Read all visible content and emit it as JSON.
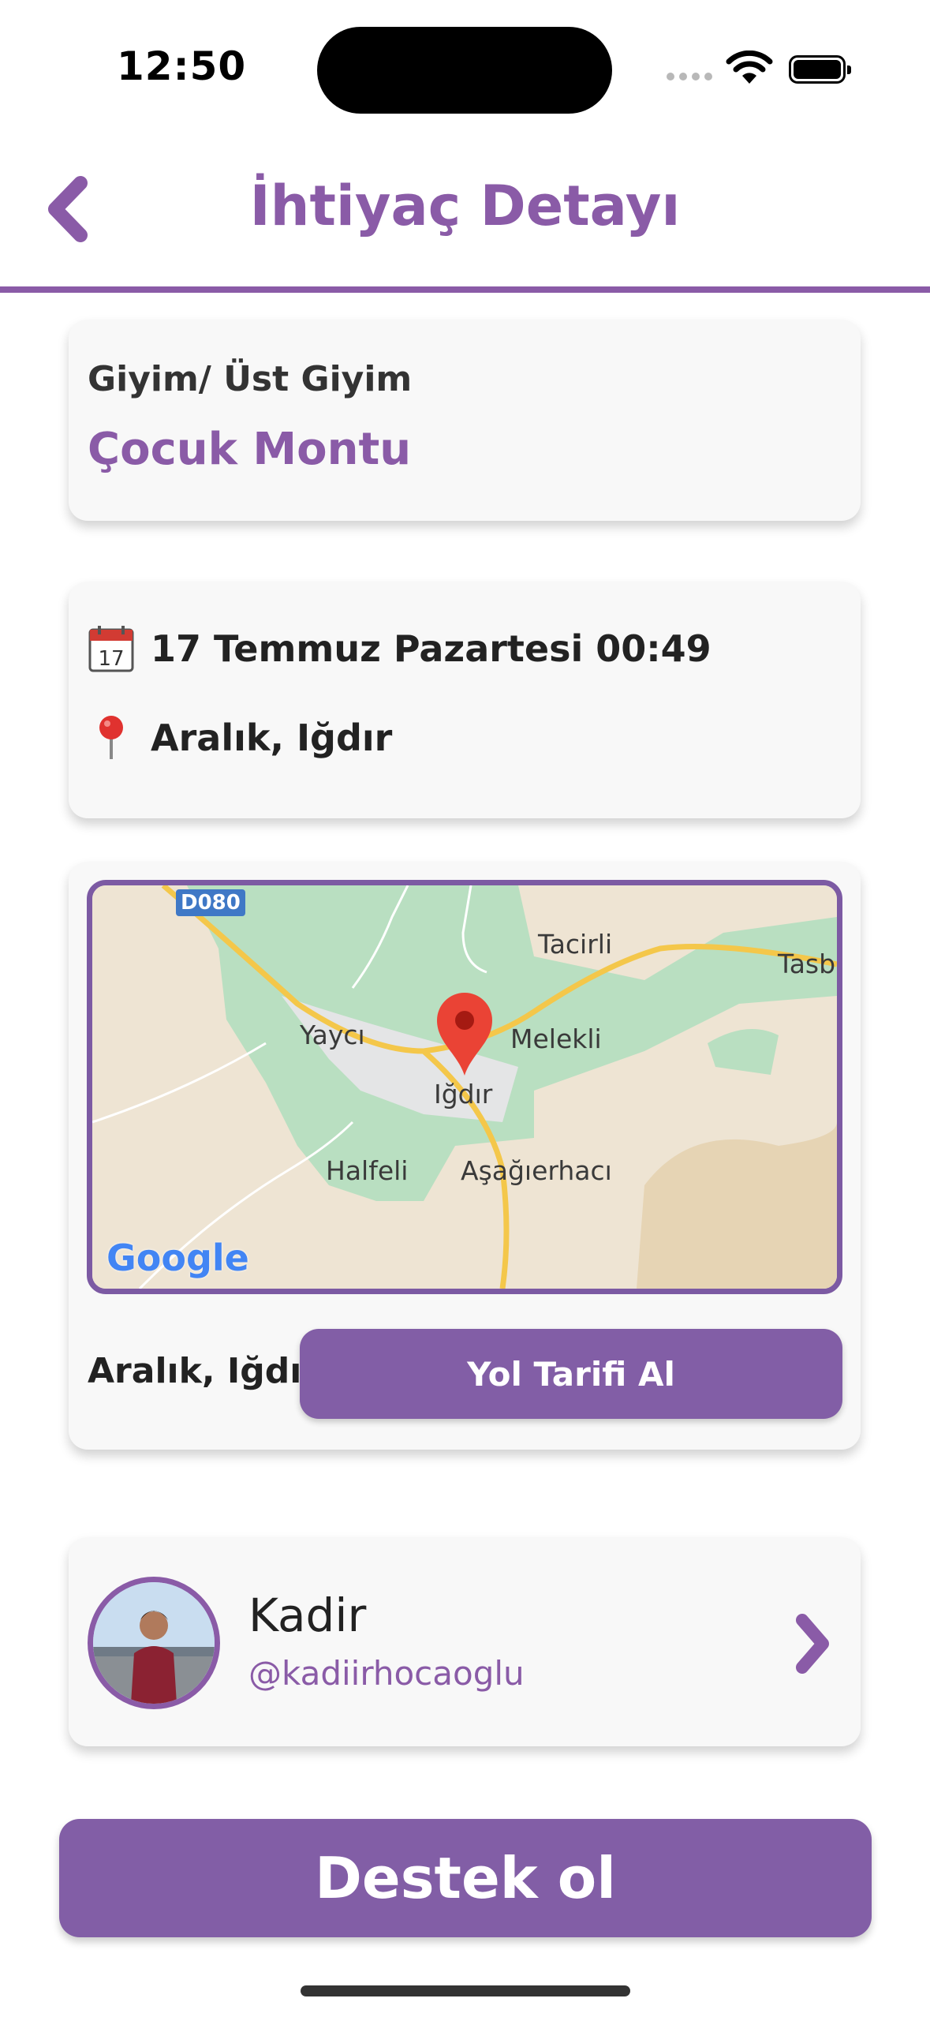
{
  "status_bar": {
    "time": "12:50"
  },
  "header": {
    "title": "İhtiyaç Detayı"
  },
  "need": {
    "category": "Giyim/ Üst Giyim",
    "item": "Çocuk Montu"
  },
  "info": {
    "date": "17 Temmuz Pazartesi 00:49",
    "location": "Aralık, Iğdır"
  },
  "map": {
    "road_badge": "D080",
    "places": [
      "Tacirli",
      "Tasbu",
      "Yaycı",
      "Melekli",
      "Iğdır",
      "Halfeli",
      "Aşağıerhacı"
    ],
    "google_logo": "Google",
    "location_label": "Aralık, Iğdır",
    "directions_button": "Yol Tarifi Al"
  },
  "user": {
    "name": "Kadir",
    "handle": "@kadiirhocaoglu"
  },
  "support_button": "Destek ol",
  "colors": {
    "accent": "#8a5ba7",
    "button": "#825ea6",
    "card": "#f8f8f8"
  },
  "icons": {
    "back": "chevron-left-icon",
    "calendar": "calendar-icon",
    "pin": "location-pin-icon",
    "user_arrow": "chevron-right-icon"
  }
}
